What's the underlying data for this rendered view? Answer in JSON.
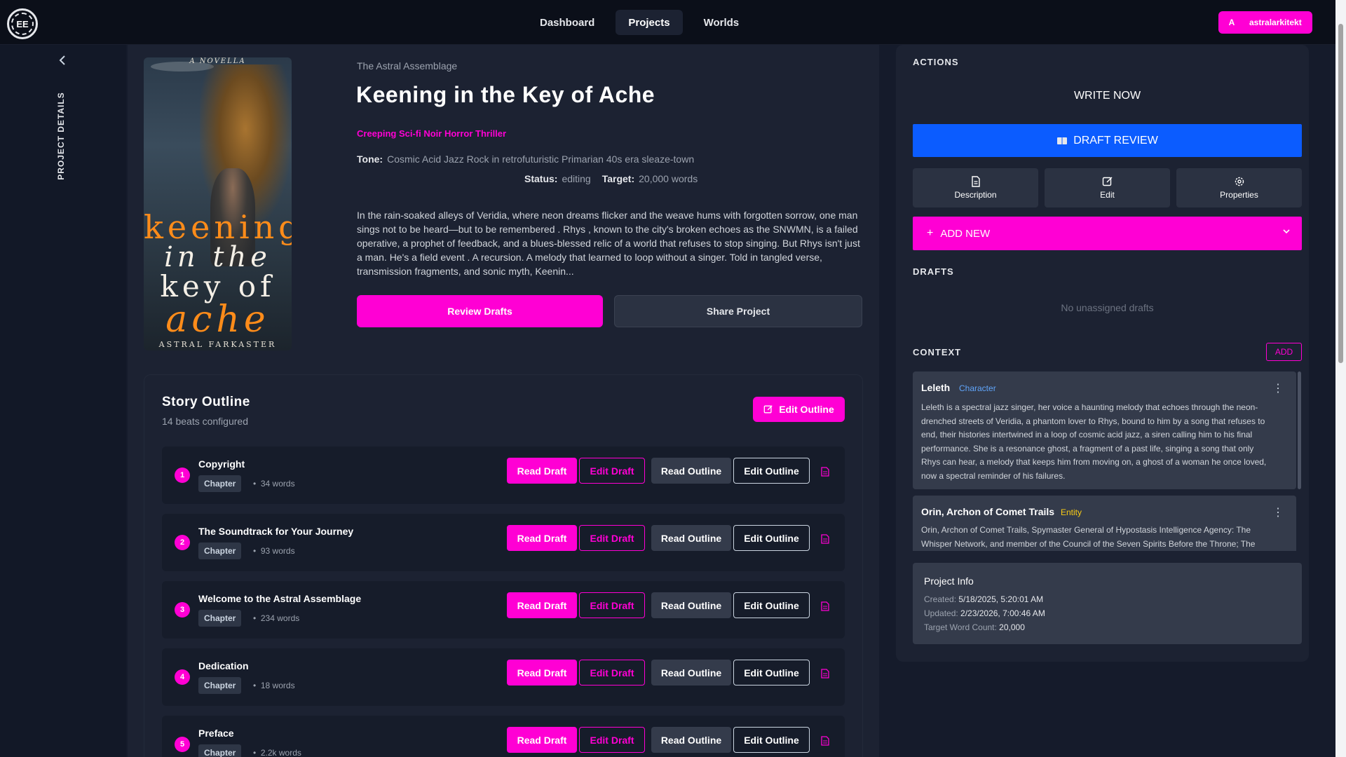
{
  "nav": {
    "logo_text": "EE",
    "links": [
      {
        "label": "Dashboard"
      },
      {
        "label": "Projects"
      },
      {
        "label": "Worlds"
      }
    ],
    "user": {
      "avatar": "A",
      "name": "astralarkitekt"
    }
  },
  "sidebar": {
    "toggle_icon": "chevron-left-icon",
    "label": "PROJECT DETAILS"
  },
  "cover": {
    "subtitle": "A NOVELLA",
    "line1": "keening",
    "line2": "in the",
    "line3": "key of",
    "line4": "ache",
    "author": "ASTRAL FARKASTER"
  },
  "project": {
    "series": "The Astral Assemblage",
    "title": "Keening in the Key of Ache",
    "genre": "Creeping Sci-fi Noir Horror Thriller",
    "tone_label": "Tone:",
    "tone": "Cosmic Acid Jazz Rock in retrofuturistic Primarian 40s era sleaze-town",
    "status_label": "Status:",
    "status": "editing",
    "target_label": "Target:",
    "target": "20,000 words",
    "description": "In the rain-soaked alleys of Veridia, where neon dreams flicker and the weave hums with forgotten sorrow, one man sings not to be heard—but to be remembered . Rhys , known to the city's broken echoes as the SNWMN, is a failed operative, a prophet of feedback, and a blues-blessed relic of a world that refuses to stop singing. But Rhys isn't just a man. He's a field event . A recursion. A melody that learned to loop without a singer. Told in tangled verse, transmission fragments, and sonic myth, Keenin...",
    "review_button": "Review Drafts",
    "share_button": "Share Project"
  },
  "outline": {
    "title": "Story Outline",
    "subtitle": "14 beats configured",
    "edit_button": "Edit Outline",
    "actions": {
      "read_draft": "Read Draft",
      "edit_draft": "Edit Draft",
      "read_outline": "Read Outline",
      "edit_outline": "Edit Outline"
    },
    "beats": [
      {
        "num": "1",
        "title": "Copyright",
        "type": "Chapter",
        "words": "34 words"
      },
      {
        "num": "2",
        "title": "The Soundtrack for Your Journey",
        "type": "Chapter",
        "words": "93 words"
      },
      {
        "num": "3",
        "title": "Welcome to the Astral Assemblage",
        "type": "Chapter",
        "words": "234 words"
      },
      {
        "num": "4",
        "title": "Dedication",
        "type": "Chapter",
        "words": "18 words"
      },
      {
        "num": "5",
        "title": "Preface",
        "type": "Chapter",
        "words": "2.2k words"
      }
    ]
  },
  "actions_panel": {
    "heading": "ACTIONS",
    "write_now": "WRITE NOW",
    "draft_review": "DRAFT REVIEW",
    "tiles": [
      {
        "label": "Description",
        "icon": "document-icon"
      },
      {
        "label": "Edit",
        "icon": "edit-icon"
      },
      {
        "label": "Properties",
        "icon": "gear-icon"
      }
    ],
    "add_new": "ADD NEW"
  },
  "drafts": {
    "heading": "DRAFTS",
    "empty": "No unassigned drafts"
  },
  "context": {
    "heading": "CONTEXT",
    "add": "ADD",
    "items": [
      {
        "name": "Leleth",
        "type": "Character",
        "type_color": "#60a5fa",
        "body": "Leleth is a spectral jazz singer, her voice a haunting melody that echoes through the neon-drenched streets of Veridia, a phantom lover to Rhys, bound to him by a song that refuses to end, their histories intertwined in a loop of cosmic acid jazz, a siren calling him to his final performance. She is a resonance ghost, a fragment of a past life, singing a song that only Rhys can hear, a melody that keeps him from moving on, a ghost of a woman he once loved, now a spectral reminder of his failures."
      },
      {
        "name": "Orin, Archon of Comet Trails",
        "type": "Entity",
        "type_color": "#facc15",
        "body": "Orin, Archon of Comet Trails, Spymaster General of Hypostasis Intelligence Agency: The Whisper Network, and member of the Council of the Seven Spirits Before the Throne; The"
      }
    ]
  },
  "project_info": {
    "title": "Project Info",
    "created_label": "Created:",
    "created": "5/18/2025, 5:20:01 AM",
    "updated_label": "Updated:",
    "updated": "2/23/2026, 7:00:46 AM",
    "target_label": "Target Word Count:",
    "target": "20,000"
  },
  "colors": {
    "accent": "#ff00d4",
    "primary_blue": "#0b5cff",
    "background": "#151b2b",
    "panel": "#1c2232"
  }
}
